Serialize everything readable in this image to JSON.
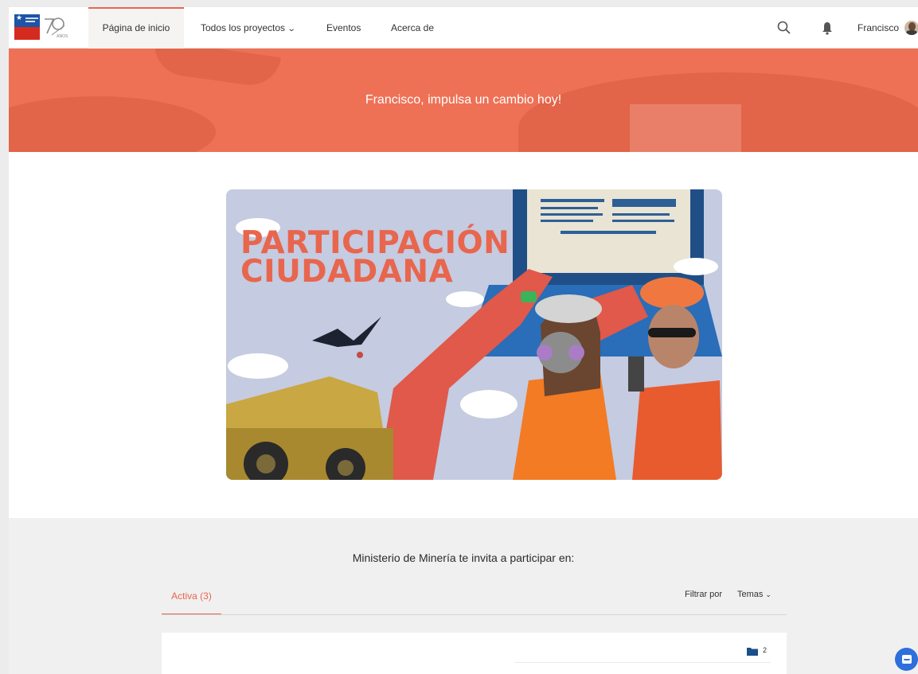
{
  "nav": {
    "items": [
      {
        "label": "Página de inicio",
        "active": true
      },
      {
        "label": "Todos los proyectos",
        "has_dropdown": true
      },
      {
        "label": "Eventos"
      },
      {
        "label": "Acerca de"
      }
    ],
    "user_name": "Francisco"
  },
  "hero": {
    "title": "Francisco, impulsa un cambio hoy!"
  },
  "banner": {
    "line1": "PARTICIPACIÓN",
    "line2": "CIUDADANA"
  },
  "content": {
    "invite_text": "Ministerio de Minería te invita a participar en:",
    "active_tab": "Activa (3)",
    "filter_label": "Filtrar por",
    "filter_value": "Temas",
    "card_count": "2"
  },
  "colors": {
    "accent": "#e8664e",
    "hero_bg": "#ee7156",
    "chat_button": "#2d6fdc"
  }
}
